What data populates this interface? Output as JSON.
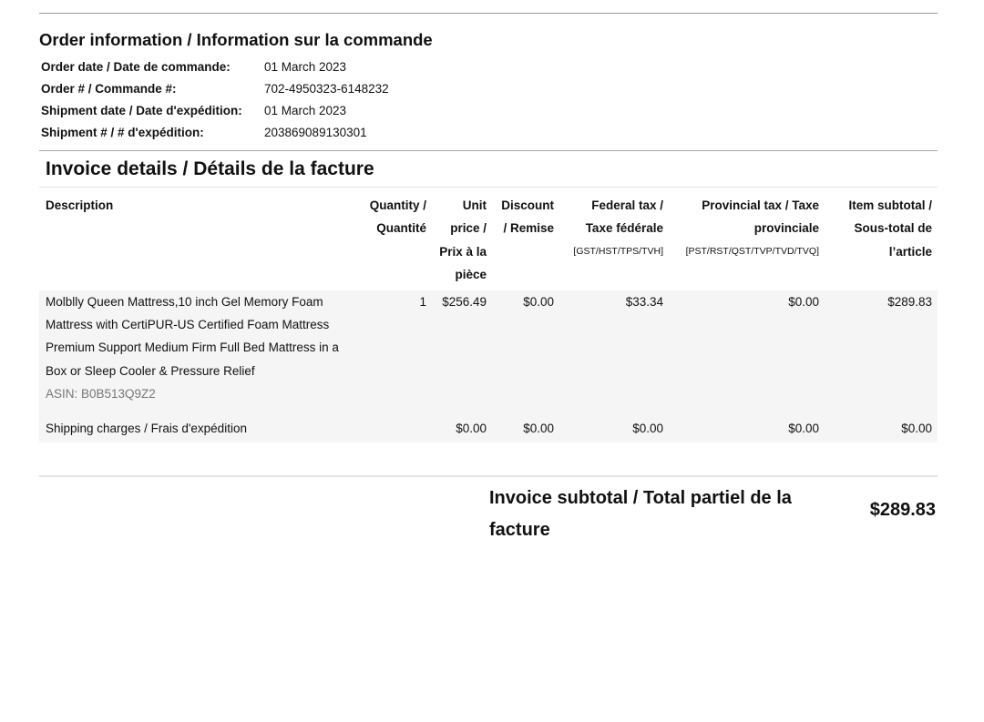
{
  "order": {
    "title": "Order information / Information sur la commande",
    "rows": [
      {
        "label": "Order date / Date de commande:",
        "value": "01 March 2023"
      },
      {
        "label": "Order # / Commande #:",
        "value": "702-4950323-6148232"
      },
      {
        "label": "Shipment date / Date d'expédition:",
        "value": "01 March 2023"
      },
      {
        "label": "Shipment # / # d'expédition:",
        "value": "203869089130301"
      }
    ]
  },
  "invoice": {
    "title": "Invoice details / Détails de la facture",
    "headers": {
      "description": "Description",
      "quantity": "Quantity / Quantité",
      "unit_price": "Unit price / Prix à la pièce",
      "discount": "Discount / Remise",
      "federal_tax": "Federal tax / Taxe fédérale",
      "federal_tax_sub": "[GST/HST/TPS/TVH]",
      "provincial_tax": "Provincial tax / Taxe provinciale",
      "provincial_tax_sub": "[PST/RST/QST/TVP/TVD/TVQ]",
      "item_subtotal": "Item subtotal / Sous-total de l’article"
    },
    "items": [
      {
        "description": "Molblly Queen Mattress,10 inch Gel Memory Foam Mattress with CertiPUR-US Certified Foam Mattress Premium Support Medium Firm Full Bed Mattress in a Box or Sleep Cooler & Pressure Relief",
        "asin": "ASIN: B0B513Q9Z2",
        "quantity": "1",
        "unit_price": "$256.49",
        "discount": "$0.00",
        "federal_tax": "$33.34",
        "provincial_tax": "$0.00",
        "item_subtotal": "$289.83"
      }
    ],
    "shipping": {
      "description": "Shipping charges / Frais d'expédition",
      "quantity": "",
      "unit_price": "$0.00",
      "discount": "$0.00",
      "federal_tax": "$0.00",
      "provincial_tax": "$0.00",
      "item_subtotal": "$0.00"
    },
    "subtotal_label": "Invoice subtotal / Total partiel de la facture",
    "subtotal_value": "$289.83"
  }
}
